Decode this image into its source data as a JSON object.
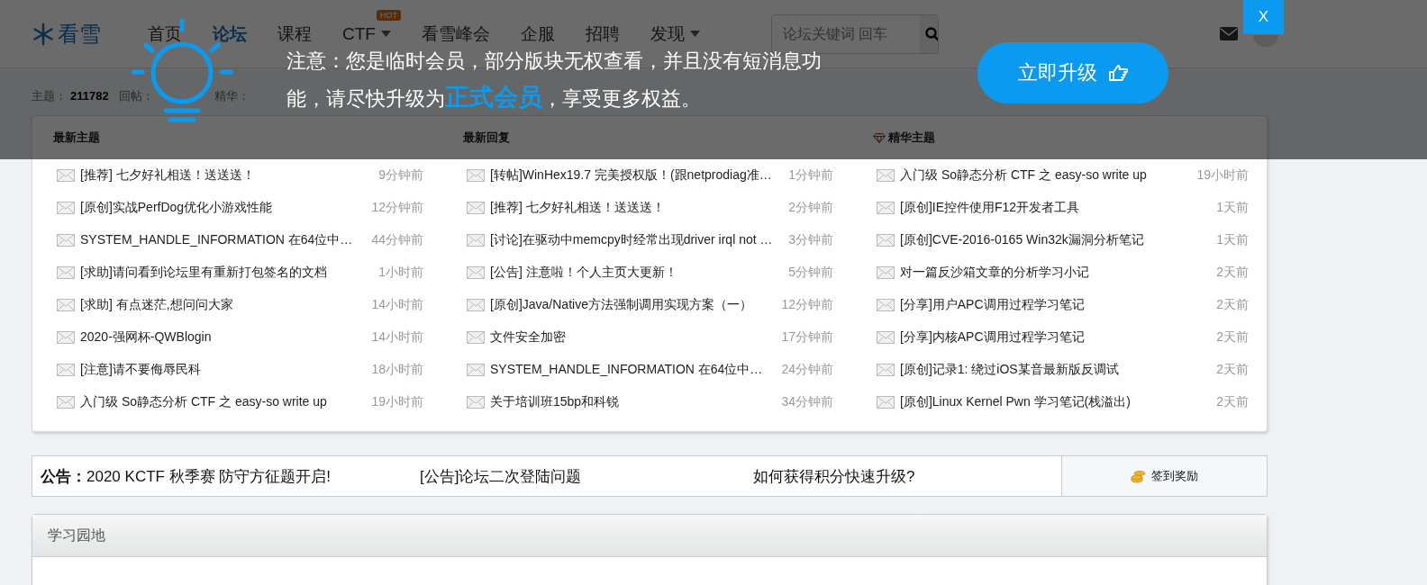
{
  "header": {
    "logo": "看雪",
    "nav": [
      {
        "label": "首页",
        "selected": false,
        "kind": "plain"
      },
      {
        "label": "论坛",
        "selected": true,
        "kind": "plain"
      },
      {
        "label": "课程",
        "selected": false,
        "kind": "plain"
      },
      {
        "label": "CTF",
        "selected": false,
        "kind": "dropdown",
        "badge": "HOT"
      },
      {
        "label": "看雪峰会",
        "selected": false,
        "kind": "plain"
      },
      {
        "label": "企服",
        "selected": false,
        "kind": "plain"
      },
      {
        "label": "招聘",
        "selected": false,
        "kind": "plain"
      },
      {
        "label": "发现",
        "selected": false,
        "kind": "dropdown"
      }
    ],
    "search": {
      "placeholder": "论坛关键词 回车"
    }
  },
  "stats": [
    {
      "label": "主题：",
      "value": "211782"
    },
    {
      "label": "回帖："
    },
    {
      "label": "精华："
    }
  ],
  "overlay": {
    "notice": "注意：您是临时会员，部分版块无权查看，并且没有短消息功能，请尽快升级为**正式会员**，享受更多权益。",
    "upgrade_button": "立即升级",
    "close_button": "X"
  },
  "panel": {
    "columns": [
      {
        "title": "最新主题",
        "kind": "plain",
        "rows": [
          {
            "title": "[推荐] 七夕好礼相送！送送送！",
            "time": "9分钟前"
          },
          {
            "title": "[原创]实战PerfDog优化小游戏性能",
            "time": "12分钟前"
          },
          {
            "title": "SYSTEM_HANDLE_INFORMATION 在64位中…",
            "time": "44分钟前"
          },
          {
            "title": "[求助]请问看到论坛里有重新打包签名的文档",
            "time": "1小时前"
          },
          {
            "title": "[求助] 有点迷茫,想问问大家",
            "time": "14小时前"
          },
          {
            "title": "2020-强网杯-QWBlogin",
            "time": "14小时前"
          },
          {
            "title": "[注意]请不要侮辱民科",
            "time": "18小时前"
          },
          {
            "title": "入门级 So静态分析 CTF 之 easy-so write up",
            "time": "19小时前"
          }
        ]
      },
      {
        "title": "最新回复",
        "kind": "plain",
        "rows": [
          {
            "title": "[转帖]WinHex19.7 完美授权版！(跟netprodiag准…",
            "time": "1分钟前"
          },
          {
            "title": "[推荐] 七夕好礼相送！送送送！",
            "time": "2分钟前"
          },
          {
            "title": "[讨论]在驱动中memcpy时经常出现driver irql not …",
            "time": "3分钟前"
          },
          {
            "title": "[公告] 注意啦！个人主页大更新！",
            "time": "5分钟前"
          },
          {
            "title": "[原创]Java/Native方法强制调用实现方案（一）",
            "time": "12分钟前"
          },
          {
            "title": "文件安全加密",
            "time": "17分钟前"
          },
          {
            "title": "SYSTEM_HANDLE_INFORMATION 在64位中…",
            "time": "24分钟前"
          },
          {
            "title": "关于培训班15bp和科锐",
            "time": "34分钟前"
          }
        ]
      },
      {
        "title": "精华主题",
        "kind": "featured",
        "rows": [
          {
            "title": "入门级 So静态分析 CTF 之 easy-so write up",
            "time": "19小时前"
          },
          {
            "title": "[原创]IE控件使用F12开发者工具",
            "time": "1天前"
          },
          {
            "title": "[原创]CVE-2016-0165 Win32k漏洞分析笔记",
            "time": "1天前"
          },
          {
            "title": "对一篇反沙箱文章的分析学习小记",
            "time": "2天前"
          },
          {
            "title": "[分享]用户APC调用过程学习笔记",
            "time": "2天前"
          },
          {
            "title": "[分享]内核APC调用过程学习笔记",
            "time": "2天前"
          },
          {
            "title": "[原创]记录1: 绕过iOS某音最新版反调试",
            "time": "2天前"
          },
          {
            "title": "[原创]Linux Kernel Pwn 学习笔记(栈溢出)",
            "time": "2天前"
          }
        ]
      }
    ]
  },
  "announcements": {
    "label": "公告：",
    "items": [
      "2020 KCTF 秋季赛 防守方征题开启!",
      "[公告]论坛二次登陆问题",
      "如何获得积分快速升级?"
    ],
    "signin_button": "签到奖励"
  },
  "section": {
    "title": "学习园地"
  }
}
